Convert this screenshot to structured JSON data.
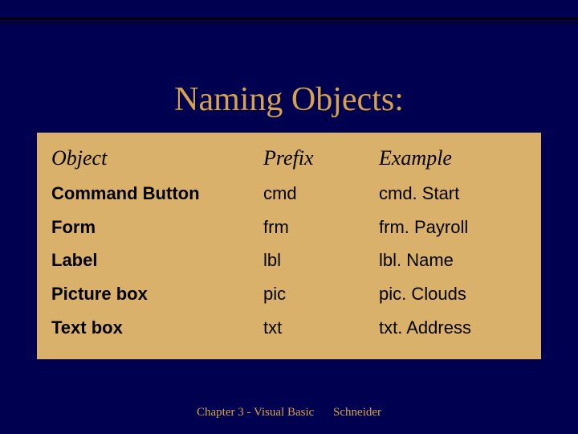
{
  "title": "Naming Objects:",
  "headers": {
    "object": "Object",
    "prefix": "Prefix",
    "example": "Example"
  },
  "rows": [
    {
      "object": "Command Button",
      "prefix": "cmd",
      "example": "cmd. Start"
    },
    {
      "object": "Form",
      "prefix": "frm",
      "example": "frm. Payroll"
    },
    {
      "object": "Label",
      "prefix": "lbl",
      "example": "lbl. Name"
    },
    {
      "object": "Picture box",
      "prefix": "pic",
      "example": "pic. Clouds"
    },
    {
      "object": "Text box",
      "prefix": "txt",
      "example": "txt. Address"
    }
  ],
  "footer": {
    "left": "Chapter 3 - Visual Basic",
    "right": "Schneider"
  }
}
